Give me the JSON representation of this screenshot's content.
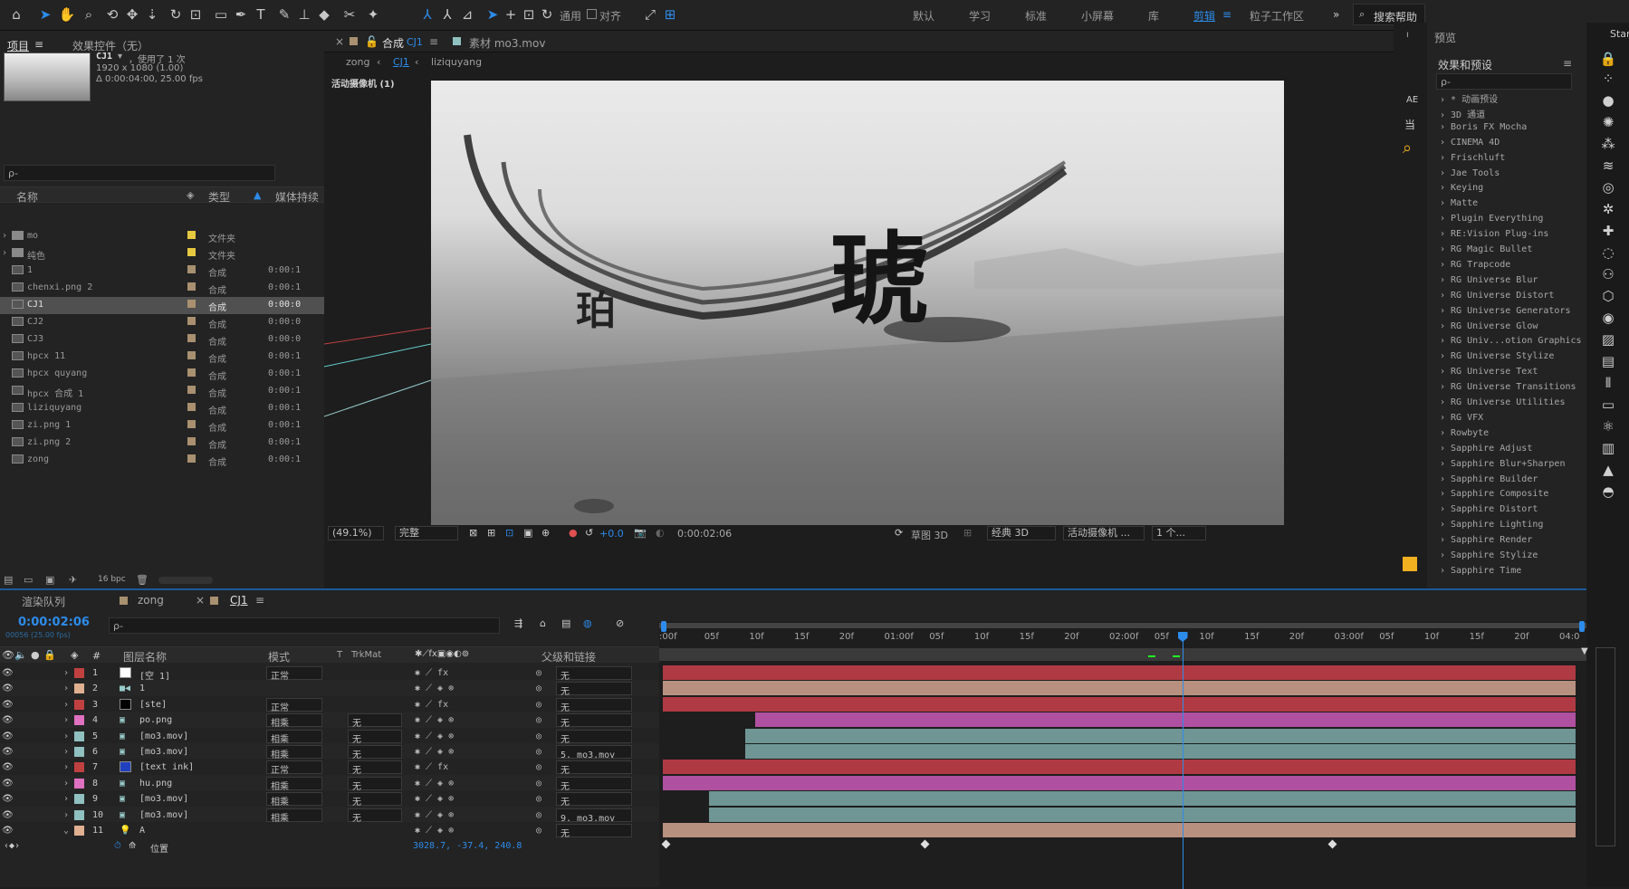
{
  "toolbar": {
    "tools": [
      "home-icon",
      "selection-icon",
      "hand-icon",
      "zoom-icon",
      "orbit-icon",
      "pan-icon",
      "dolly-icon",
      "rotate-icon",
      "anchor-icon",
      "rect-mask-icon",
      "pen-icon",
      "text-icon",
      "brush-icon",
      "stamp-icon",
      "eraser-icon",
      "roto-icon",
      "puppet-icon"
    ],
    "general_label": "通用",
    "align_label": "对齐",
    "workspaces": [
      "默认",
      "学习",
      "标准",
      "小屏幕",
      "库",
      "剪辑",
      "粒子工作区"
    ],
    "active_workspace": "剪辑",
    "search_help": "搜索帮助"
  },
  "project": {
    "tab_label": "项目",
    "effects_tab": "效果控件（无）",
    "comp_name": "CJ1",
    "used": "，使用了 1 次",
    "resolution": "1920 x 1080 (1.00)",
    "duration": "Δ 0:00:04:00, 25.00 fps",
    "search_placeholder": "ρ-",
    "col_name": "名称",
    "col_type": "类型",
    "col_media": "媒体持续",
    "bpc": "16 bpc",
    "items": [
      {
        "name": "mo",
        "type": "文件夹",
        "dur": "",
        "color": "#e6c940",
        "folder": true
      },
      {
        "name": "纯色",
        "type": "文件夹",
        "dur": "",
        "color": "#e6c940",
        "folder": true
      },
      {
        "name": "1",
        "type": "合成",
        "dur": "0:00:1",
        "color": "#a89070"
      },
      {
        "name": "chenxi.png 2",
        "type": "合成",
        "dur": "0:00:1",
        "color": "#a89070"
      },
      {
        "name": "CJ1",
        "type": "合成",
        "dur": "0:00:0",
        "color": "#a89070",
        "sel": true
      },
      {
        "name": "CJ2",
        "type": "合成",
        "dur": "0:00:0",
        "color": "#a89070"
      },
      {
        "name": "CJ3",
        "type": "合成",
        "dur": "0:00:0",
        "color": "#a89070"
      },
      {
        "name": "hpcx 11",
        "type": "合成",
        "dur": "0:00:1",
        "color": "#a89070"
      },
      {
        "name": "hpcx quyang",
        "type": "合成",
        "dur": "0:00:1",
        "color": "#a89070"
      },
      {
        "name": "hpcx 合成 1",
        "type": "合成",
        "dur": "0:00:1",
        "color": "#a89070"
      },
      {
        "name": "liziquyang",
        "type": "合成",
        "dur": "0:00:1",
        "color": "#a89070"
      },
      {
        "name": "zi.png 1",
        "type": "合成",
        "dur": "0:00:1",
        "color": "#a89070"
      },
      {
        "name": "zi.png 2",
        "type": "合成",
        "dur": "0:00:1",
        "color": "#a89070"
      },
      {
        "name": "zong",
        "type": "合成",
        "dur": "0:00:1",
        "color": "#a89070"
      }
    ]
  },
  "viewer": {
    "comp_tab": "合成",
    "comp_name": "CJ1",
    "footage_tab": "素材 mo3.mov",
    "breadcrumbs": [
      "zong",
      "CJ1",
      "liziquyang"
    ],
    "camera_label": "活动摄像机 (1)",
    "big_char": "琥",
    "small_char": "珀",
    "zoom": "(49.1%)",
    "quality": "完整",
    "exposure": "+0.0",
    "timecode": "0:00:02:06",
    "draft3d": "草图 3D",
    "renderer": "经典 3D",
    "camera": "活动摄像机 ...",
    "views": "1 个..."
  },
  "side_labels": {
    "ae": "AE",
    "dang": "当"
  },
  "effects": {
    "preview_title": "预览",
    "title": "效果和预设",
    "search_placeholder": "ρ-",
    "items": [
      "* 动画预设",
      "3D 通道",
      "Boris FX Mocha",
      "CINEMA 4D",
      "Frischluft",
      "Jae Tools",
      "Keying",
      "Matte",
      "Plugin Everything",
      "RE:Vision Plug-ins",
      "RG Magic Bullet",
      "RG Trapcode",
      "RG Universe Blur",
      "RG Universe Distort",
      "RG Universe Generators",
      "RG Universe Glow",
      "RG Univ...otion Graphics",
      "RG Universe Stylize",
      "RG Universe Text",
      "RG Universe Transitions",
      "RG Universe Utilities",
      "RG VFX",
      "Rowbyte",
      "Sapphire Adjust",
      "Sapphire Blur+Sharpen",
      "Sapphire Builder",
      "Sapphire Composite",
      "Sapphire Distort",
      "Sapphire Lighting",
      "Sapphire Render",
      "Sapphire Stylize",
      "Sapphire Time"
    ]
  },
  "right_header": "Start",
  "timeline": {
    "render_tab": "渲染队列",
    "tab_zong": "zong",
    "tab_cj1": "CJ1",
    "timecode": "0:00:02:06",
    "frames": "00056 (25.00 fps)",
    "search_placeholder": "ρ-",
    "col_layer": "图层名称",
    "col_mode": "模式",
    "col_t": "T",
    "col_trkmat": "TrkMat",
    "col_parent": "父级和链接",
    "ruler": [
      ":00f",
      "05f",
      "10f",
      "15f",
      "20f",
      "01:00f",
      "05f",
      "10f",
      "15f",
      "20f",
      "02:00f",
      "05f",
      "10f",
      "15f",
      "20f",
      "03:00f",
      "05f",
      "10f",
      "15f",
      "20f",
      "04:0"
    ],
    "layers": [
      {
        "num": "1",
        "name": "[空 1]",
        "mode": "正常",
        "trk": "",
        "parent": "无",
        "color": "#c04040",
        "sw": "#ffffff",
        "bar": "#b03a44",
        "bstart": 0.0,
        "bend": 1.0,
        "fx": true
      },
      {
        "num": "2",
        "name": "1",
        "mode": "",
        "trk": "",
        "parent": "无",
        "color": "#e0b090",
        "sw": "cam",
        "bar": "#b89080",
        "bstart": 0.0,
        "bend": 1.0
      },
      {
        "num": "3",
        "name": "[ste]",
        "mode": "正常",
        "trk": "",
        "parent": "无",
        "color": "#c04040",
        "sw": "#000000",
        "bar": "#b03a44",
        "bstart": 0.0,
        "bend": 1.0,
        "fx": true
      },
      {
        "num": "4",
        "name": "po.png",
        "mode": "相乘",
        "trk": "无",
        "parent": "无",
        "color": "#e070c0",
        "sw": "img",
        "bar": "#b050a0",
        "bstart": 0.1,
        "bend": 1.0
      },
      {
        "num": "5",
        "name": "[mo3.mov]",
        "mode": "相乘",
        "trk": "无",
        "parent": "无",
        "color": "#90c0c0",
        "sw": "mov",
        "bar": "#6f9595",
        "bstart": 0.09,
        "bend": 1.0
      },
      {
        "num": "6",
        "name": "[mo3.mov]",
        "mode": "相乘",
        "trk": "无",
        "parent": "5. mo3.mov",
        "color": "#90c0c0",
        "sw": "mov",
        "bar": "#6f9595",
        "bstart": 0.09,
        "bend": 1.0
      },
      {
        "num": "7",
        "name": "[text ink]",
        "mode": "正常",
        "trk": "无",
        "parent": "无",
        "color": "#c04040",
        "sw": "#2040c0",
        "bar": "#b03a44",
        "bstart": 0.0,
        "bend": 1.0,
        "fx": true
      },
      {
        "num": "8",
        "name": "hu.png",
        "mode": "相乘",
        "trk": "无",
        "parent": "无",
        "color": "#e070c0",
        "sw": "img",
        "bar": "#b050a0",
        "bstart": 0.0,
        "bend": 1.0
      },
      {
        "num": "9",
        "name": "[mo3.mov]",
        "mode": "相乘",
        "trk": "无",
        "parent": "无",
        "color": "#90c0c0",
        "sw": "mov",
        "bar": "#6f9595",
        "bstart": 0.05,
        "bend": 1.0
      },
      {
        "num": "10",
        "name": "[mo3.mov]",
        "mode": "相乘",
        "trk": "无",
        "parent": "9. mo3.mov",
        "color": "#90c0c0",
        "sw": "mov",
        "bar": "#6f9595",
        "bstart": 0.05,
        "bend": 1.0
      },
      {
        "num": "11",
        "name": "A",
        "mode": "",
        "trk": "",
        "parent": "无",
        "color": "#e0b090",
        "sw": "light",
        "bar": "#b89080",
        "bstart": 0.0,
        "bend": 1.0
      }
    ],
    "position_label": "位置",
    "position_value": "3028.7, -37.4, 240.8",
    "playhead_fraction": 0.564
  }
}
